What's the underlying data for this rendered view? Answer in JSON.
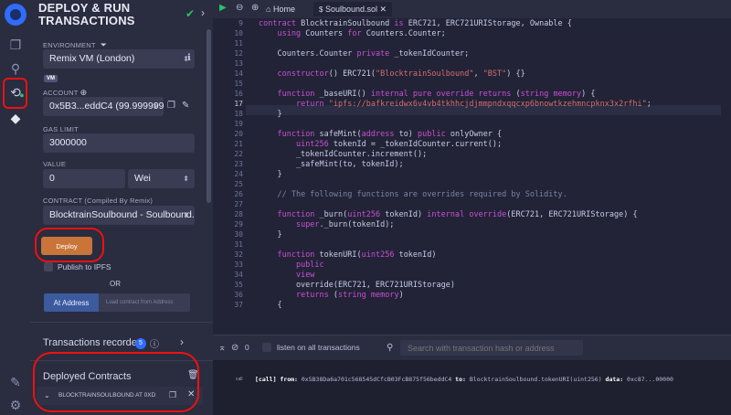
{
  "icon_rail": [
    {
      "icon": "remix-logo-icon"
    },
    {
      "icon": "file-explorer-icon"
    },
    {
      "icon": "search-icon"
    },
    {
      "icon": "compiler-icon"
    },
    {
      "icon": "deploy-run-icon"
    },
    {
      "icon": "plugin-manager-icon"
    },
    {
      "icon": "settings-icon"
    }
  ],
  "panel": {
    "title_line1": "DEPLOY & RUN",
    "title_line2": "TRANSACTIONS",
    "environment_label": "ENVIRONMENT",
    "environment_value": "Remix VM (London)",
    "vm_badge": "VM",
    "account_label": "ACCOUNT",
    "account_value": "0x5B3...eddC4 (99.9999999",
    "gas_limit_label": "GAS LIMIT",
    "gas_limit_value": "3000000",
    "value_label": "VALUE",
    "value_amount": "0",
    "value_unit": "Wei",
    "contract_label": "CONTRACT (Compiled By Remix)",
    "contract_value": "BlocktrainSoulbound - Soulbound.so",
    "deploy_label": "Deploy",
    "publish_ipfs_label": "Publish to IPFS",
    "or_label": "OR",
    "at_address_label": "At Address",
    "load_address_placeholder": "Load contract from Address",
    "transactions_recorded_label": "Transactions recorded",
    "transactions_count": "5",
    "deployed_contracts_label": "Deployed Contracts",
    "deployed_item_label": "BLOCKTRAINSOULBOUND AT 0XD"
  },
  "tabs": {
    "home_label": "Home",
    "file_label": "Soulbound.sol"
  },
  "editor": {
    "active_line": 17,
    "lines": [
      {
        "n": "9",
        "html": "<span class='kw'>contract</span> BlocktrainSoulbound <span class='kw'>is</span> ERC721, ERC721URIStorage, Ownable {"
      },
      {
        "n": "10",
        "html": "    <span class='kw'>using</span> Counters <span class='kw'>for</span> Counters.Counter;"
      },
      {
        "n": "11",
        "html": ""
      },
      {
        "n": "12",
        "html": "    Counters.Counter <span class='kw'>private</span> _tokenIdCounter;"
      },
      {
        "n": "13",
        "html": ""
      },
      {
        "n": "14",
        "html": "    <span class='kw'>constructor</span>() ERC721(<span class='str'>\"BlocktrainSoulbound\"</span>, <span class='str'>\"BST\"</span>) {}"
      },
      {
        "n": "15",
        "html": ""
      },
      {
        "n": "16",
        "html": "    <span class='kw'>function</span> _baseURI() <span class='kw'>internal pure override returns</span> (<span class='ty'>string memory</span>) {"
      },
      {
        "n": "17",
        "html": "        <span class='kw'>return</span> <span class='str'>\"ipfs://bafkreidwx6v4vb4tkhhcjdjmmpndxqqcxp6bnowtkzehmncpknx3x2rfhi\"</span>;"
      },
      {
        "n": "18",
        "html": "    }"
      },
      {
        "n": "19",
        "html": ""
      },
      {
        "n": "20",
        "html": "    <span class='kw'>function</span> safeMint(<span class='ty'>address</span> to) <span class='kw'>public</span> onlyOwner {"
      },
      {
        "n": "21",
        "html": "        <span class='ty'>uint256</span> tokenId = _tokenIdCounter.current();"
      },
      {
        "n": "22",
        "html": "        _tokenIdCounter.increment();"
      },
      {
        "n": "23",
        "html": "        _safeMint(to, tokenId);"
      },
      {
        "n": "24",
        "html": "    }"
      },
      {
        "n": "25",
        "html": ""
      },
      {
        "n": "26",
        "html": "    <span class='cm'>// The following functions are overrides required by Solidity.</span>"
      },
      {
        "n": "27",
        "html": ""
      },
      {
        "n": "28",
        "html": "    <span class='kw'>function</span> _burn(<span class='ty'>uint256</span> tokenId) <span class='kw'>internal override</span>(ERC721, ERC721URIStorage) {"
      },
      {
        "n": "29",
        "html": "        <span class='kw'>super</span>._burn(tokenId);"
      },
      {
        "n": "30",
        "html": "    }"
      },
      {
        "n": "31",
        "html": ""
      },
      {
        "n": "32",
        "html": "    <span class='kw'>function</span> tokenURI(<span class='ty'>uint256</span> tokenId)"
      },
      {
        "n": "33",
        "html": "        <span class='kw'>public</span>"
      },
      {
        "n": "34",
        "html": "        <span class='kw'>view</span>"
      },
      {
        "n": "35",
        "html": "        override(ERC721, ERC721URIStorage)"
      },
      {
        "n": "36",
        "html": "        <span class='kw'>returns</span> (<span class='ty'>string memory</span>)"
      },
      {
        "n": "37",
        "html": "    {"
      }
    ]
  },
  "terminal": {
    "count": "0",
    "listen_label": "listen on all transactions",
    "search_placeholder": "Search with transaction hash or address",
    "call_tag": "call",
    "log_html": "<span style='color:#ffffff;font-weight:bold'>[call]</span> <b style='color:#fff'>from:</b> 0x5B38Da6a701c568545dCfcB03FcB875f56beddC4 <b style='color:#fff'>to:</b> BlocktrainSoulbound.tokenURI(uint256) <b style='color:#fff'>data:</b> 0xc87...00000"
  },
  "colors": {
    "background": "#222336",
    "panel": "#2a2c3f",
    "deploy_button": "#c97539",
    "annotation_red": "#e11111",
    "accent_blue": "#2f6cff",
    "success_green": "#2bbf6e"
  }
}
